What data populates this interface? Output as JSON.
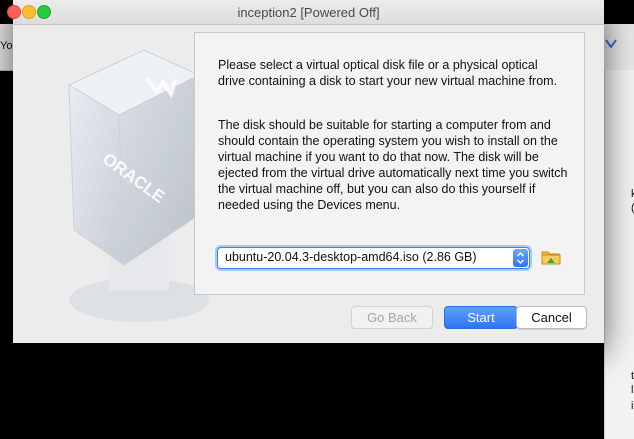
{
  "window": {
    "title": "inception2 [Powered Off]"
  },
  "background": {
    "left_text": "Yo",
    "right_chars": [
      "k",
      "(",
      "t",
      "l",
      "i"
    ]
  },
  "dialog": {
    "paragraph1": "Please select a virtual optical disk file or a physical optical drive containing a disk to start your new virtual machine from.",
    "paragraph2": "The disk should be suitable for starting a computer from and should contain the operating system you wish to install on the virtual machine if you want to do that now. The disk will be ejected from the virtual drive automatically next time you switch the virtual machine off, but you can also do this yourself if needed using the Devices menu.",
    "disk_select": {
      "value": "ubuntu-20.04.3-desktop-amd64.iso (2.86 GB)"
    },
    "logo_text": "ORACLE",
    "buttons": {
      "back": "Go Back",
      "start": "Start",
      "cancel": "Cancel"
    }
  },
  "colors": {
    "accent": "#2f74f0",
    "close": "#fe5f57",
    "minimize": "#febc2e",
    "maximize": "#28c840"
  },
  "icons": [
    "close-icon",
    "minimize-icon",
    "maximize-icon",
    "chevron-updown-icon",
    "folder-icon"
  ]
}
